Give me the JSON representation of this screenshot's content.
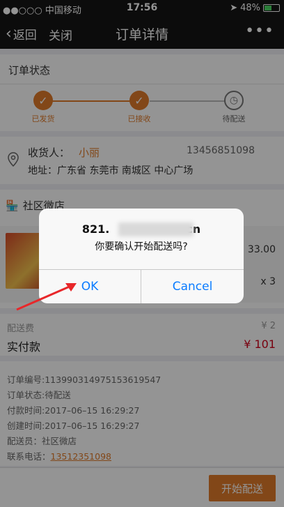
{
  "status_bar": {
    "carrier": "●●○○○ 中国移动",
    "wifi_icon": "wifi-icon",
    "time": "17:56",
    "battery": "48%"
  },
  "nav": {
    "back_label": "返回",
    "close_label": "关闭",
    "title": "订单详情",
    "more_label": "•••"
  },
  "order_status": {
    "header": "订单状态",
    "steps": [
      {
        "label": "已发货",
        "state": "done"
      },
      {
        "label": "已接收",
        "state": "done"
      },
      {
        "label": "待配送",
        "state": "pending"
      }
    ],
    "accent": "#e07b2a"
  },
  "recipient": {
    "name_label": "收货人：",
    "name": "小丽",
    "phone": "13456851098",
    "address": "地址：广东省 东莞市 南城区 中心广场"
  },
  "store": {
    "name": "社区微店",
    "item_price": "33.00",
    "item_qty": "x 3"
  },
  "fees": {
    "delivery_label": "配送费",
    "delivery_value": "¥ 2",
    "paid_label": "实付款",
    "paid_value": "¥ 101"
  },
  "meta": {
    "order_no": "订单编号:113990314975153619547",
    "order_status": "订单状态:待配送",
    "pay_time": "付款时间:2017–06–15 16:29:27",
    "create_time": "创建时间:2017–06–15 16:29:27",
    "courier": "配送员：社区微店",
    "phone_label": "联系电话：",
    "phone": "13512351098"
  },
  "bottom": {
    "start_delivery": "开始配送"
  },
  "dialog": {
    "title_visible": "821.",
    "title_suffix": "cn",
    "message": "你要确认开始配送吗?",
    "ok": "OK",
    "cancel": "Cancel"
  }
}
